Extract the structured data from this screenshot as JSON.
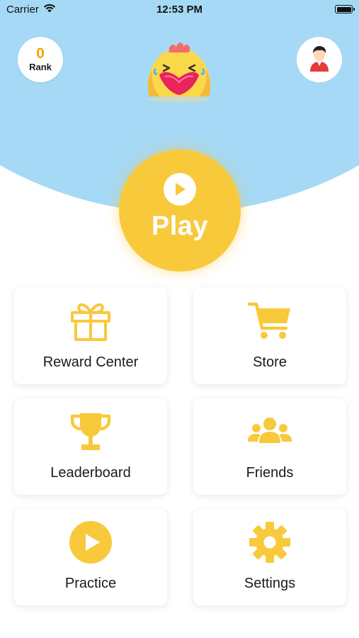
{
  "status_bar": {
    "carrier": "Carrier",
    "time": "12:53 PM"
  },
  "header": {
    "rank_value": "0",
    "rank_label": "Rank",
    "profile_icon": "user-avatar-icon",
    "mascot_icon": "chick-mascot-icon"
  },
  "play": {
    "label": "Play",
    "icon": "play-icon"
  },
  "menu": {
    "items": [
      {
        "label": "Reward Center",
        "icon": "gift-icon"
      },
      {
        "label": "Store",
        "icon": "cart-icon"
      },
      {
        "label": "Leaderboard",
        "icon": "trophy-icon"
      },
      {
        "label": "Friends",
        "icon": "friends-icon"
      },
      {
        "label": "Practice",
        "icon": "play-circle-icon"
      },
      {
        "label": "Settings",
        "icon": "gear-icon"
      }
    ]
  },
  "colors": {
    "sky": "#a6d9f5",
    "accent_yellow": "#f8c93b",
    "rank_orange": "#f5a500"
  }
}
